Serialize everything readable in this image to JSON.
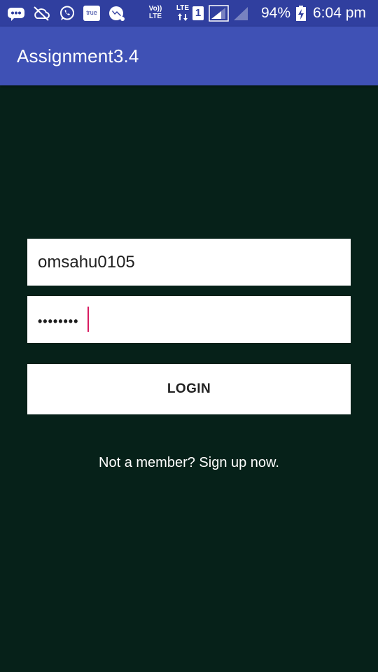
{
  "status_bar": {
    "icons": [
      "messenger-chat-icon",
      "cloud-off-icon",
      "whatsapp-icon",
      "true-app-icon",
      "video-chat-icon",
      "volte-icon",
      "lte-data-icon",
      "sim-1-icon",
      "signal-bars-icon",
      "signal-bars-empty-icon",
      "battery-charging-icon"
    ],
    "volte_label": "Vo)) LTE",
    "lte_label": "LTE",
    "sim_number": "1",
    "true_label": "true",
    "battery_percent": "94%",
    "time": "6:04 pm"
  },
  "app_bar": {
    "title": "Assignment3.4"
  },
  "form": {
    "username_value": "omsahu0105",
    "password_value": "••••••••",
    "login_label": "LOGIN",
    "signup_text": "Not a member? Sign up now."
  },
  "colors": {
    "status_bar": "#303F9F",
    "app_bar": "#3F51B5",
    "background": "#062119",
    "cursor_accent": "#D81B60",
    "field_background": "#FFFFFF"
  }
}
